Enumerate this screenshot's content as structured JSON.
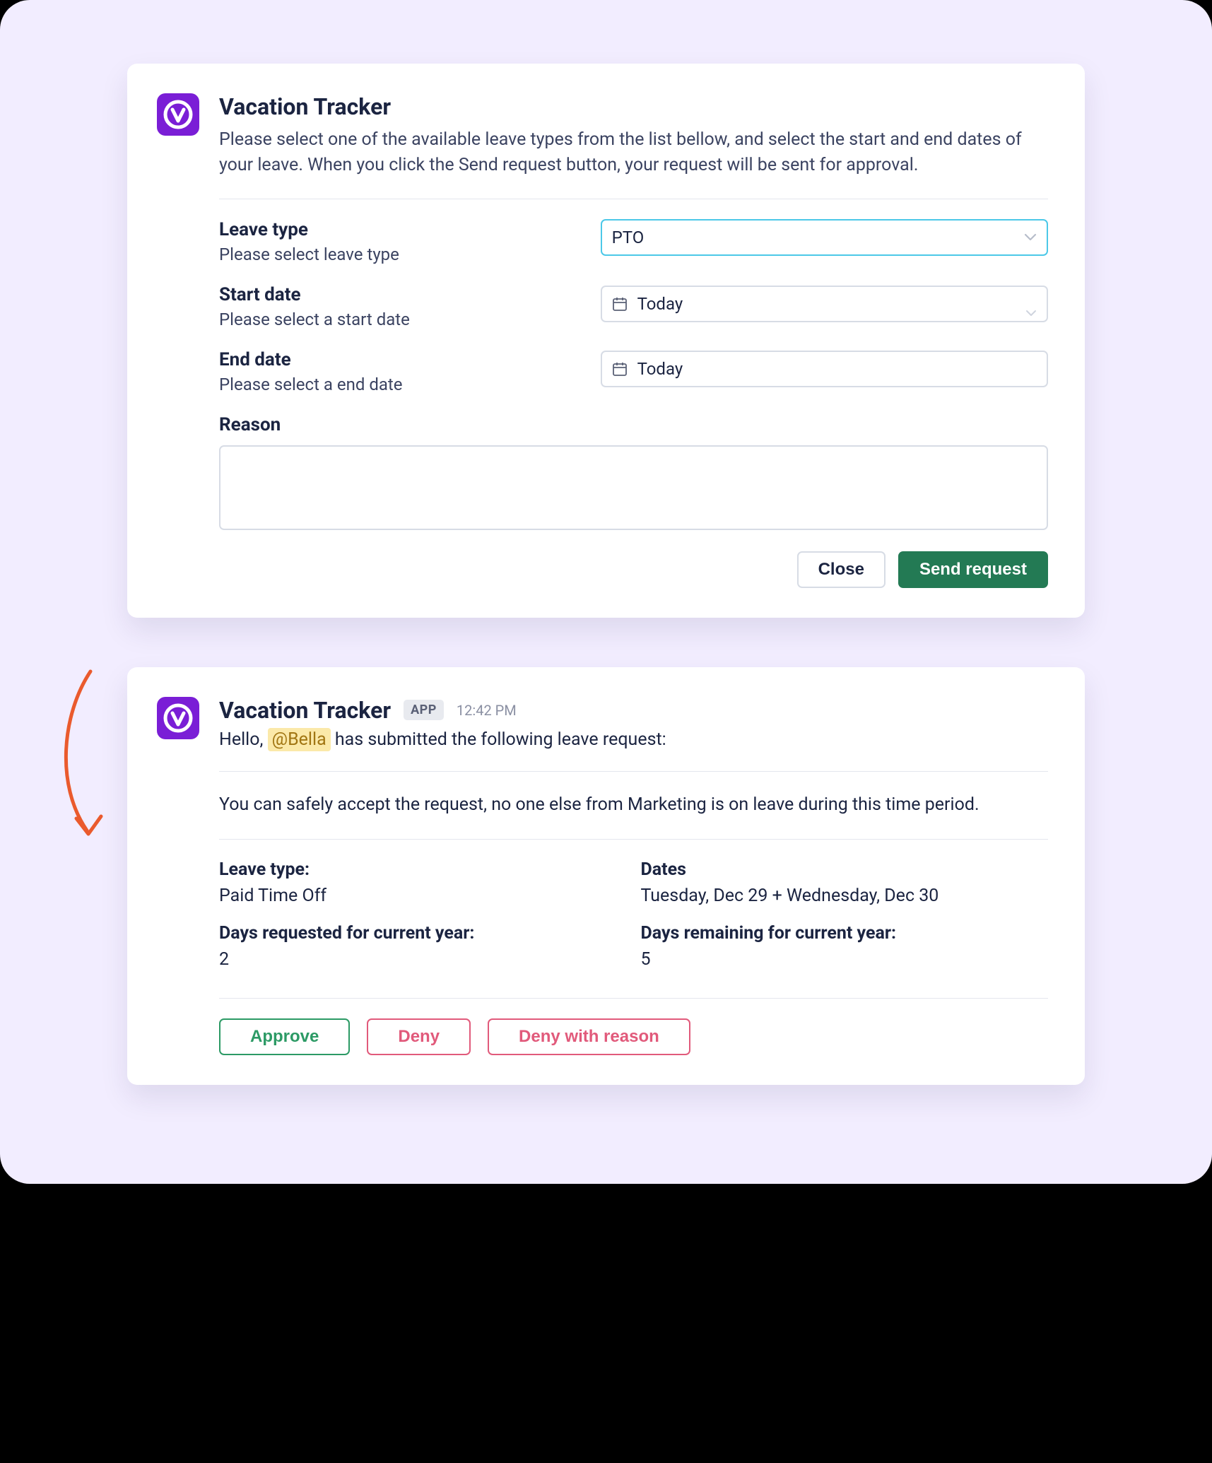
{
  "colors": {
    "accent_purple": "#7a1ed6",
    "primary_green": "#237a54",
    "outline_green": "#2c9a65",
    "outline_red": "#e15a7b",
    "select_active_border": "#4cc8e8",
    "arrow": "#ea5a2d"
  },
  "form_card": {
    "app_name": "Vacation Tracker",
    "description": "Please select one of the available leave types from the list bellow, and select the start and end dates of your leave. When you click the Send request button, your request will be sent for approval.",
    "leave_type": {
      "label": "Leave type",
      "help": "Please select leave type",
      "value": "PTO"
    },
    "start_date": {
      "label": "Start date",
      "help": "Please select a start date",
      "value": "Today"
    },
    "end_date": {
      "label": "End date",
      "help": "Please select a end date",
      "value": "Today"
    },
    "reason": {
      "label": "Reason",
      "value": ""
    },
    "actions": {
      "close": "Close",
      "send": "Send request"
    }
  },
  "message_card": {
    "app_name": "Vacation Tracker",
    "badge": "APP",
    "timestamp": "12:42 PM",
    "greeting_prefix": "Hello, ",
    "mention": "@Bella",
    "greeting_suffix": " has submitted the following leave request:",
    "info": "You can safely accept the request, no one else from Marketing is on leave during this time period.",
    "fields": {
      "leave_type_label": "Leave type:",
      "leave_type_value": "Paid Time Off",
      "dates_label": "Dates",
      "dates_value": "Tuesday, Dec 29 + Wednesday, Dec 30",
      "days_requested_label": "Days requested for current year:",
      "days_requested_value": "2",
      "days_remaining_label": "Days remaining for current year:",
      "days_remaining_value": "5"
    },
    "actions": {
      "approve": "Approve",
      "deny": "Deny",
      "deny_reason": "Deny with reason"
    }
  }
}
